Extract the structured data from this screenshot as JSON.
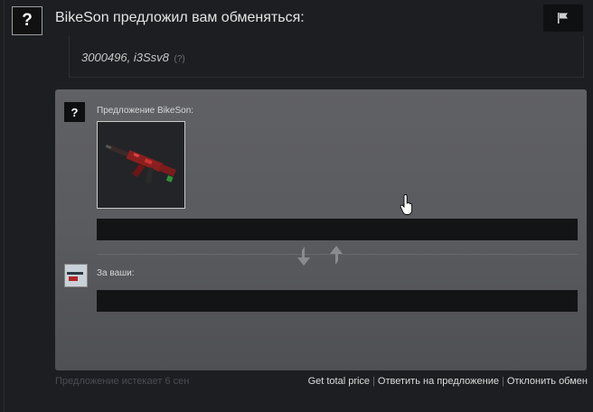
{
  "header": {
    "avatar_glyph": "?",
    "title": "BikeSon предложил вам обменяться:",
    "flag_icon": "flag-icon"
  },
  "message": {
    "text": "3000496, i3Ssv8",
    "help": "(?)"
  },
  "offer": {
    "avatar_glyph": "?",
    "label": "Предложение BikeSon:",
    "item_icon": "rifle-skin-icon"
  },
  "swap_icons": [
    "swap-down-arrow-icon",
    "swap-up-arrow-icon"
  ],
  "yours": {
    "label": "За ваши:",
    "avatar_icon": "user-avatar-icon"
  },
  "footer": {
    "expires": "Предложение истекает 6 сен",
    "actions": [
      "Get total price",
      "Ответить на предложение",
      "Отклонить обмен"
    ]
  },
  "colors": {
    "background": "#1d1e22",
    "panel": "#5c5d61",
    "bar": "#131416"
  }
}
